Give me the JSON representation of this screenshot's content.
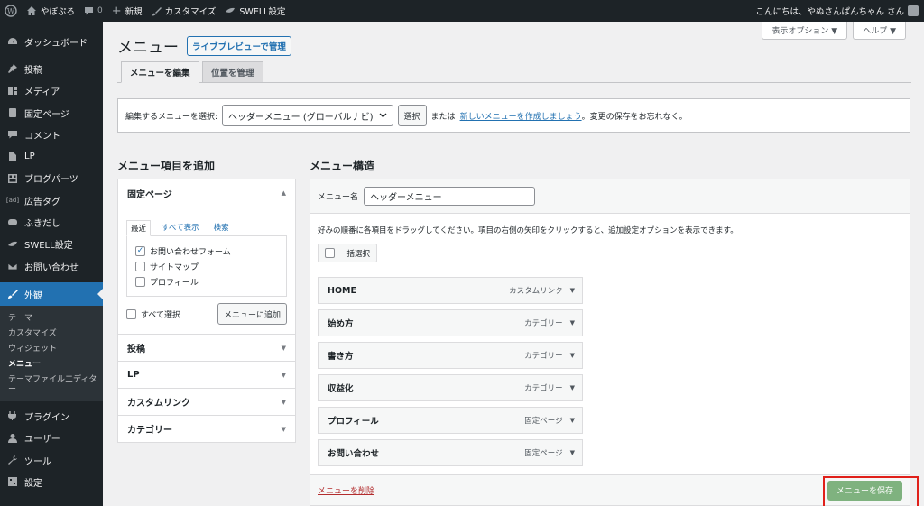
{
  "adminbar": {
    "site": "やぼぷろ",
    "comments": "0",
    "new": "新規",
    "customize": "カスタマイズ",
    "swell": "SWELL設定",
    "greeting": "こんにちは、やぬさんぱんちゃん さん"
  },
  "sidebar": {
    "items": [
      {
        "label": "ダッシュボード",
        "icon": "gauge-icon"
      },
      {
        "label": "投稿",
        "icon": "pin-icon"
      },
      {
        "label": "メディア",
        "icon": "media-icon"
      },
      {
        "label": "固定ページ",
        "icon": "page-icon"
      },
      {
        "label": "コメント",
        "icon": "comment-icon"
      },
      {
        "label": "LP",
        "icon": "doc-icon"
      },
      {
        "label": "ブログパーツ",
        "icon": "blocks-icon"
      },
      {
        "label": "広告タグ",
        "icon": "ad-icon"
      },
      {
        "label": "ふきだし",
        "icon": "bubble-icon"
      },
      {
        "label": "SWELL設定",
        "icon": "swell-icon"
      },
      {
        "label": "お問い合わせ",
        "icon": "mail-icon"
      }
    ],
    "current": "外観",
    "sub": [
      "テーマ",
      "カスタマイズ",
      "ウィジェット",
      "メニュー",
      "テーマファイルエディター"
    ],
    "bottom": [
      {
        "label": "プラグイン",
        "icon": "plugin-icon"
      },
      {
        "label": "ユーザー",
        "icon": "user-icon"
      },
      {
        "label": "ツール",
        "icon": "wrench-icon"
      },
      {
        "label": "設定",
        "icon": "settings-icon"
      }
    ]
  },
  "screen": {
    "options": "表示オプション ▼",
    "help": "ヘルプ ▼"
  },
  "page": {
    "title": "メニュー",
    "live": "ライブプレビューで管理",
    "tab_edit": "メニューを編集",
    "tab_locations": "位置を管理"
  },
  "manage": {
    "label": "編集するメニューを選択:",
    "selected": "ヘッダーメニュー (グローバルナビ)",
    "select_btn": "選択",
    "or": "または",
    "create_link": "新しいメニューを作成しましょう",
    "suffix": "。変更の保存をお忘れなく。"
  },
  "left": {
    "heading": "メニュー項目を追加",
    "pages_title": "固定ページ",
    "tabs": [
      "最近",
      "すべて表示",
      "検索"
    ],
    "pages": [
      {
        "label": "お問い合わせフォーム",
        "checked": true
      },
      {
        "label": "サイトマップ",
        "checked": false
      },
      {
        "label": "プロフィール",
        "checked": false
      }
    ],
    "select_all": "すべて選択",
    "add_btn": "メニューに追加",
    "sections": [
      "投稿",
      "LP",
      "カスタムリンク",
      "カテゴリー"
    ]
  },
  "right": {
    "heading": "メニュー構造",
    "name_label": "メニュー名",
    "name_value": "ヘッダーメニュー",
    "desc": "好みの順番に各項目をドラッグしてください。項目の右側の矢印をクリックすると、追加設定オプションを表示できます。",
    "bulk": "一括選択",
    "items": [
      {
        "title": "HOME",
        "type": "カスタムリンク"
      },
      {
        "title": "始め方",
        "type": "カテゴリー"
      },
      {
        "title": "書き方",
        "type": "カテゴリー"
      },
      {
        "title": "収益化",
        "type": "カテゴリー"
      },
      {
        "title": "プロフィール",
        "type": "固定ページ"
      },
      {
        "title": "お問い合わせ",
        "type": "固定ページ"
      }
    ],
    "delete": "メニューを削除",
    "save": "メニューを保存"
  },
  "colors": {
    "accent": "#2271b1",
    "save": "#7fb27f",
    "highlight": "#e0201a"
  }
}
